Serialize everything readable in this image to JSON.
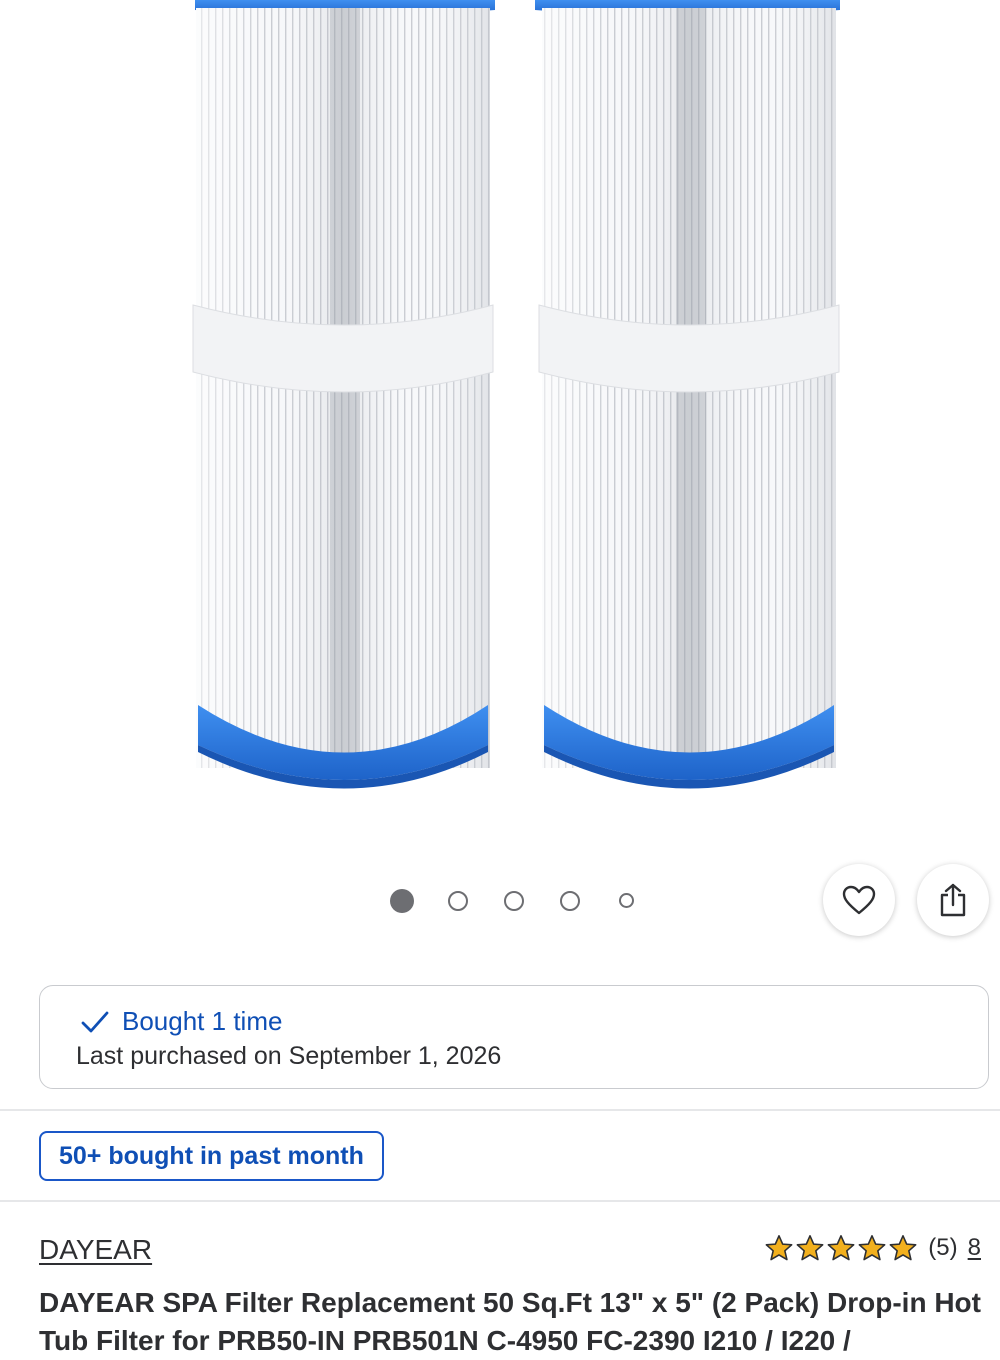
{
  "product_image": {
    "alt": "Two white pleated spa filter cartridges with blue end caps"
  },
  "carousel": {
    "total_images": 5,
    "active_index": 0
  },
  "actions": {
    "favorite_icon": "heart-icon",
    "share_icon": "share-icon"
  },
  "purchase_history": {
    "check_icon": "checkmark-icon",
    "bought_label": "Bought 1 time",
    "last_purchased": "Last purchased on September 1, 2026"
  },
  "popularity_badge": {
    "label": "50+ bought in past month"
  },
  "product": {
    "brand": "DAYEAR",
    "rating": 5,
    "rating_label": "(5)",
    "review_count": "8",
    "title": "DAYEAR SPA Filter Replacement 50 Sq.Ft 13\" x 5\" (2 Pack) Drop-in Hot Tub Filter for PRB50-IN PRB501N C-4950 FC-2390 I210 / I220 /"
  },
  "colors": {
    "accent_blue": "#0f4fb5",
    "star_gold": "#f2b01e",
    "filter_cap_blue": "#2a7de1"
  }
}
